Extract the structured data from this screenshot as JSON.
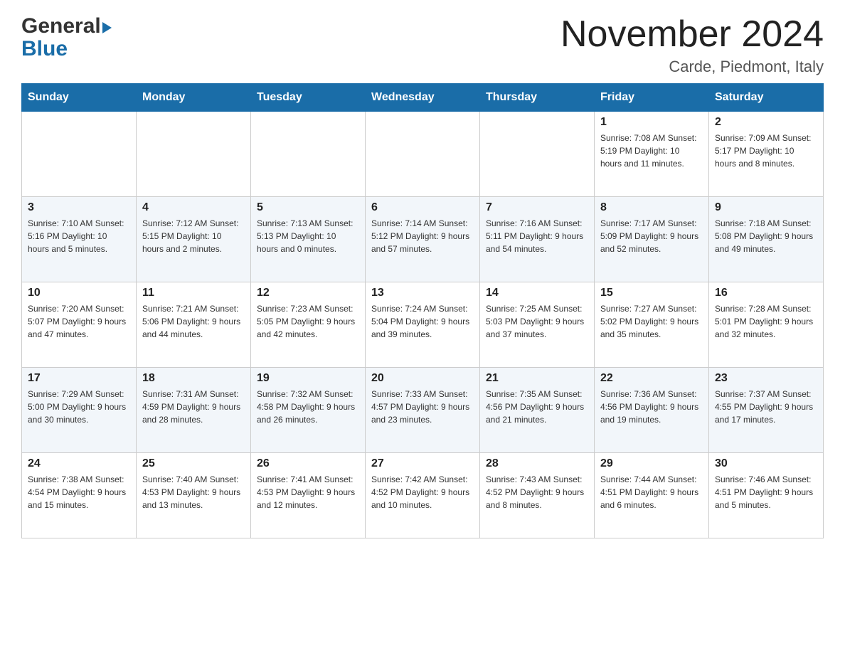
{
  "header": {
    "logo_general": "General",
    "logo_blue": "Blue",
    "month_title": "November 2024",
    "location": "Carde, Piedmont, Italy"
  },
  "weekdays": [
    "Sunday",
    "Monday",
    "Tuesday",
    "Wednesday",
    "Thursday",
    "Friday",
    "Saturday"
  ],
  "weeks": [
    {
      "days": [
        {
          "number": "",
          "info": ""
        },
        {
          "number": "",
          "info": ""
        },
        {
          "number": "",
          "info": ""
        },
        {
          "number": "",
          "info": ""
        },
        {
          "number": "",
          "info": ""
        },
        {
          "number": "1",
          "info": "Sunrise: 7:08 AM\nSunset: 5:19 PM\nDaylight: 10 hours\nand 11 minutes."
        },
        {
          "number": "2",
          "info": "Sunrise: 7:09 AM\nSunset: 5:17 PM\nDaylight: 10 hours\nand 8 minutes."
        }
      ]
    },
    {
      "days": [
        {
          "number": "3",
          "info": "Sunrise: 7:10 AM\nSunset: 5:16 PM\nDaylight: 10 hours\nand 5 minutes."
        },
        {
          "number": "4",
          "info": "Sunrise: 7:12 AM\nSunset: 5:15 PM\nDaylight: 10 hours\nand 2 minutes."
        },
        {
          "number": "5",
          "info": "Sunrise: 7:13 AM\nSunset: 5:13 PM\nDaylight: 10 hours\nand 0 minutes."
        },
        {
          "number": "6",
          "info": "Sunrise: 7:14 AM\nSunset: 5:12 PM\nDaylight: 9 hours\nand 57 minutes."
        },
        {
          "number": "7",
          "info": "Sunrise: 7:16 AM\nSunset: 5:11 PM\nDaylight: 9 hours\nand 54 minutes."
        },
        {
          "number": "8",
          "info": "Sunrise: 7:17 AM\nSunset: 5:09 PM\nDaylight: 9 hours\nand 52 minutes."
        },
        {
          "number": "9",
          "info": "Sunrise: 7:18 AM\nSunset: 5:08 PM\nDaylight: 9 hours\nand 49 minutes."
        }
      ]
    },
    {
      "days": [
        {
          "number": "10",
          "info": "Sunrise: 7:20 AM\nSunset: 5:07 PM\nDaylight: 9 hours\nand 47 minutes."
        },
        {
          "number": "11",
          "info": "Sunrise: 7:21 AM\nSunset: 5:06 PM\nDaylight: 9 hours\nand 44 minutes."
        },
        {
          "number": "12",
          "info": "Sunrise: 7:23 AM\nSunset: 5:05 PM\nDaylight: 9 hours\nand 42 minutes."
        },
        {
          "number": "13",
          "info": "Sunrise: 7:24 AM\nSunset: 5:04 PM\nDaylight: 9 hours\nand 39 minutes."
        },
        {
          "number": "14",
          "info": "Sunrise: 7:25 AM\nSunset: 5:03 PM\nDaylight: 9 hours\nand 37 minutes."
        },
        {
          "number": "15",
          "info": "Sunrise: 7:27 AM\nSunset: 5:02 PM\nDaylight: 9 hours\nand 35 minutes."
        },
        {
          "number": "16",
          "info": "Sunrise: 7:28 AM\nSunset: 5:01 PM\nDaylight: 9 hours\nand 32 minutes."
        }
      ]
    },
    {
      "days": [
        {
          "number": "17",
          "info": "Sunrise: 7:29 AM\nSunset: 5:00 PM\nDaylight: 9 hours\nand 30 minutes."
        },
        {
          "number": "18",
          "info": "Sunrise: 7:31 AM\nSunset: 4:59 PM\nDaylight: 9 hours\nand 28 minutes."
        },
        {
          "number": "19",
          "info": "Sunrise: 7:32 AM\nSunset: 4:58 PM\nDaylight: 9 hours\nand 26 minutes."
        },
        {
          "number": "20",
          "info": "Sunrise: 7:33 AM\nSunset: 4:57 PM\nDaylight: 9 hours\nand 23 minutes."
        },
        {
          "number": "21",
          "info": "Sunrise: 7:35 AM\nSunset: 4:56 PM\nDaylight: 9 hours\nand 21 minutes."
        },
        {
          "number": "22",
          "info": "Sunrise: 7:36 AM\nSunset: 4:56 PM\nDaylight: 9 hours\nand 19 minutes."
        },
        {
          "number": "23",
          "info": "Sunrise: 7:37 AM\nSunset: 4:55 PM\nDaylight: 9 hours\nand 17 minutes."
        }
      ]
    },
    {
      "days": [
        {
          "number": "24",
          "info": "Sunrise: 7:38 AM\nSunset: 4:54 PM\nDaylight: 9 hours\nand 15 minutes."
        },
        {
          "number": "25",
          "info": "Sunrise: 7:40 AM\nSunset: 4:53 PM\nDaylight: 9 hours\nand 13 minutes."
        },
        {
          "number": "26",
          "info": "Sunrise: 7:41 AM\nSunset: 4:53 PM\nDaylight: 9 hours\nand 12 minutes."
        },
        {
          "number": "27",
          "info": "Sunrise: 7:42 AM\nSunset: 4:52 PM\nDaylight: 9 hours\nand 10 minutes."
        },
        {
          "number": "28",
          "info": "Sunrise: 7:43 AM\nSunset: 4:52 PM\nDaylight: 9 hours\nand 8 minutes."
        },
        {
          "number": "29",
          "info": "Sunrise: 7:44 AM\nSunset: 4:51 PM\nDaylight: 9 hours\nand 6 minutes."
        },
        {
          "number": "30",
          "info": "Sunrise: 7:46 AM\nSunset: 4:51 PM\nDaylight: 9 hours\nand 5 minutes."
        }
      ]
    }
  ]
}
